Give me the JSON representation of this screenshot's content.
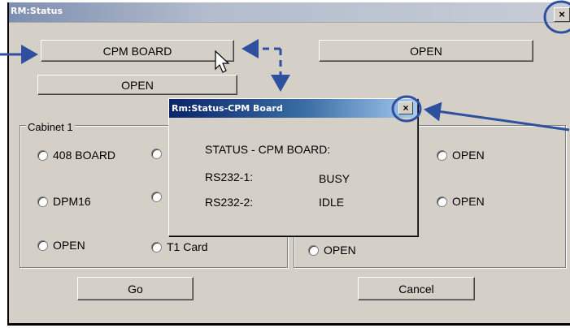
{
  "main_window": {
    "title": "RM:Status",
    "close_glyph": "×"
  },
  "top_buttons": {
    "cpm_board": "CPM BOARD",
    "open_right": "OPEN",
    "open_second": "OPEN"
  },
  "cabinet1": {
    "legend": "Cabinet 1",
    "radios": [
      "408 BOARD",
      "DPM16",
      "OPEN",
      "T1 Card"
    ]
  },
  "cabinet2": {
    "radios": [
      "OPEN",
      "OPEN",
      "OPEN"
    ]
  },
  "footer": {
    "go": "Go",
    "cancel": "Cancel"
  },
  "popup": {
    "title": "Rm:Status-CPM Board",
    "close_glyph": "×",
    "heading": "STATUS - CPM BOARD:",
    "rows": [
      {
        "port": "RS232-1:",
        "state": "BUSY"
      },
      {
        "port": "RS232-2:",
        "state": "IDLE"
      }
    ]
  },
  "colors": {
    "callout_blue": "#2f4f9f",
    "dialog_face": "#d4d0c8",
    "active_title": "#0a246a"
  },
  "icons": [
    "close-icon",
    "mouse-pointer-icon",
    "radio-icon"
  ]
}
